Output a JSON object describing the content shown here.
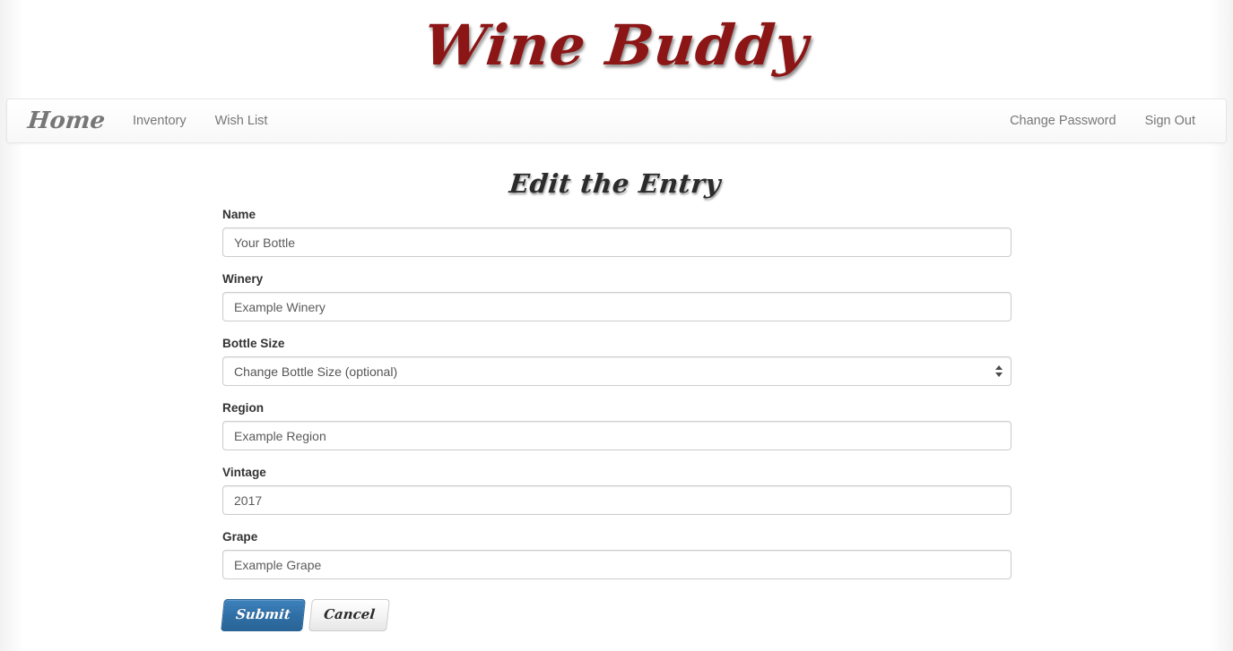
{
  "brand": {
    "title": "Wine Buddy",
    "color": "#8c1515"
  },
  "navbar": {
    "brand_label": "Home",
    "left_links": [
      {
        "label": "Inventory"
      },
      {
        "label": "Wish List"
      }
    ],
    "right_links": [
      {
        "label": "Change Password"
      },
      {
        "label": "Sign Out"
      }
    ]
  },
  "main": {
    "heading": "Edit the Entry",
    "fields": [
      {
        "key": "name",
        "label": "Name",
        "type": "text",
        "value": "",
        "placeholder": "Your Bottle"
      },
      {
        "key": "winery",
        "label": "Winery",
        "type": "text",
        "value": "",
        "placeholder": "Example Winery"
      },
      {
        "key": "bottle_size",
        "label": "Bottle Size",
        "type": "select",
        "value": "",
        "placeholder": "Change Bottle Size (optional)",
        "selected_option": "Change Bottle Size (optional)"
      },
      {
        "key": "region",
        "label": "Region",
        "type": "text",
        "value": "",
        "placeholder": "Example Region"
      },
      {
        "key": "vintage",
        "label": "Vintage",
        "type": "text",
        "value": "",
        "placeholder": "2017"
      },
      {
        "key": "grape",
        "label": "Grape",
        "type": "text",
        "value": "",
        "placeholder": "Example Grape"
      }
    ],
    "buttons": {
      "submit_label": "Submit",
      "cancel_label": "Cancel"
    }
  }
}
